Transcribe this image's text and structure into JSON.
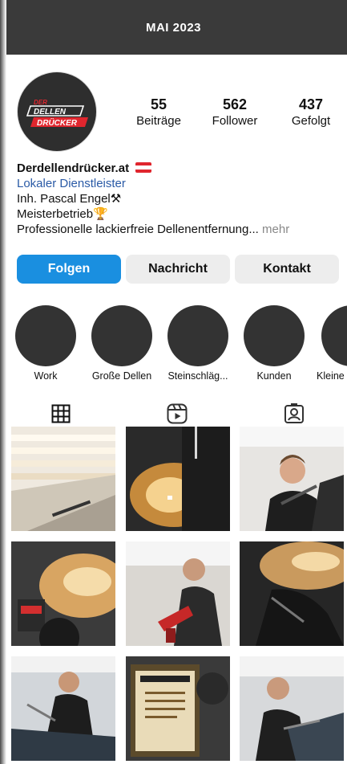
{
  "header": {
    "title": "MAI 2023"
  },
  "profile": {
    "avatar_text_top": "DER",
    "avatar_text_mid": "DELLEN",
    "avatar_text_bottom": "DRÜCKER",
    "stats": [
      {
        "value": "55",
        "label": "Beiträge"
      },
      {
        "value": "562",
        "label": "Follower"
      },
      {
        "value": "437",
        "label": "Gefolgt"
      }
    ],
    "name": "Derdellendrücker.at",
    "category": "Lokaler Dienstleister",
    "bio_line1": "Inh. Pascal Engel",
    "bio_line1_emoji": "⚒",
    "bio_line2": "Meisterbetrieb",
    "bio_line2_emoji": "🏆",
    "bio_line3": "Professionelle lackierfreie Dellenentfernung...",
    "more_label": "mehr",
    "flag_colors": [
      "#e0262e",
      "#ffffff",
      "#e0262e"
    ]
  },
  "buttons": {
    "follow": "Folgen",
    "message": "Nachricht",
    "contact": "Kontakt"
  },
  "highlights": [
    {
      "label": "Work"
    },
    {
      "label": "Große Dellen"
    },
    {
      "label": "Steinschläg..."
    },
    {
      "label": "Kunden"
    },
    {
      "label": "Kleine"
    }
  ],
  "tabs": [
    {
      "icon": "grid-icon"
    },
    {
      "icon": "reels-icon"
    },
    {
      "icon": "tagged-icon"
    }
  ],
  "colors": {
    "accent": "#1a8fe0",
    "topbar": "#3a3a3a",
    "category": "#2a5aa6"
  },
  "posts": [
    {
      "subject": "light-panel"
    },
    {
      "subject": "car-door-reflection"
    },
    {
      "subject": "technician-smiling"
    },
    {
      "subject": "glue-gun-on-car"
    },
    {
      "subject": "technician-hot-glue"
    },
    {
      "subject": "car-body-closeup"
    },
    {
      "subject": "technician-working"
    },
    {
      "subject": "meisterbrief-certificate"
    },
    {
      "subject": "technician-car-detail"
    }
  ]
}
